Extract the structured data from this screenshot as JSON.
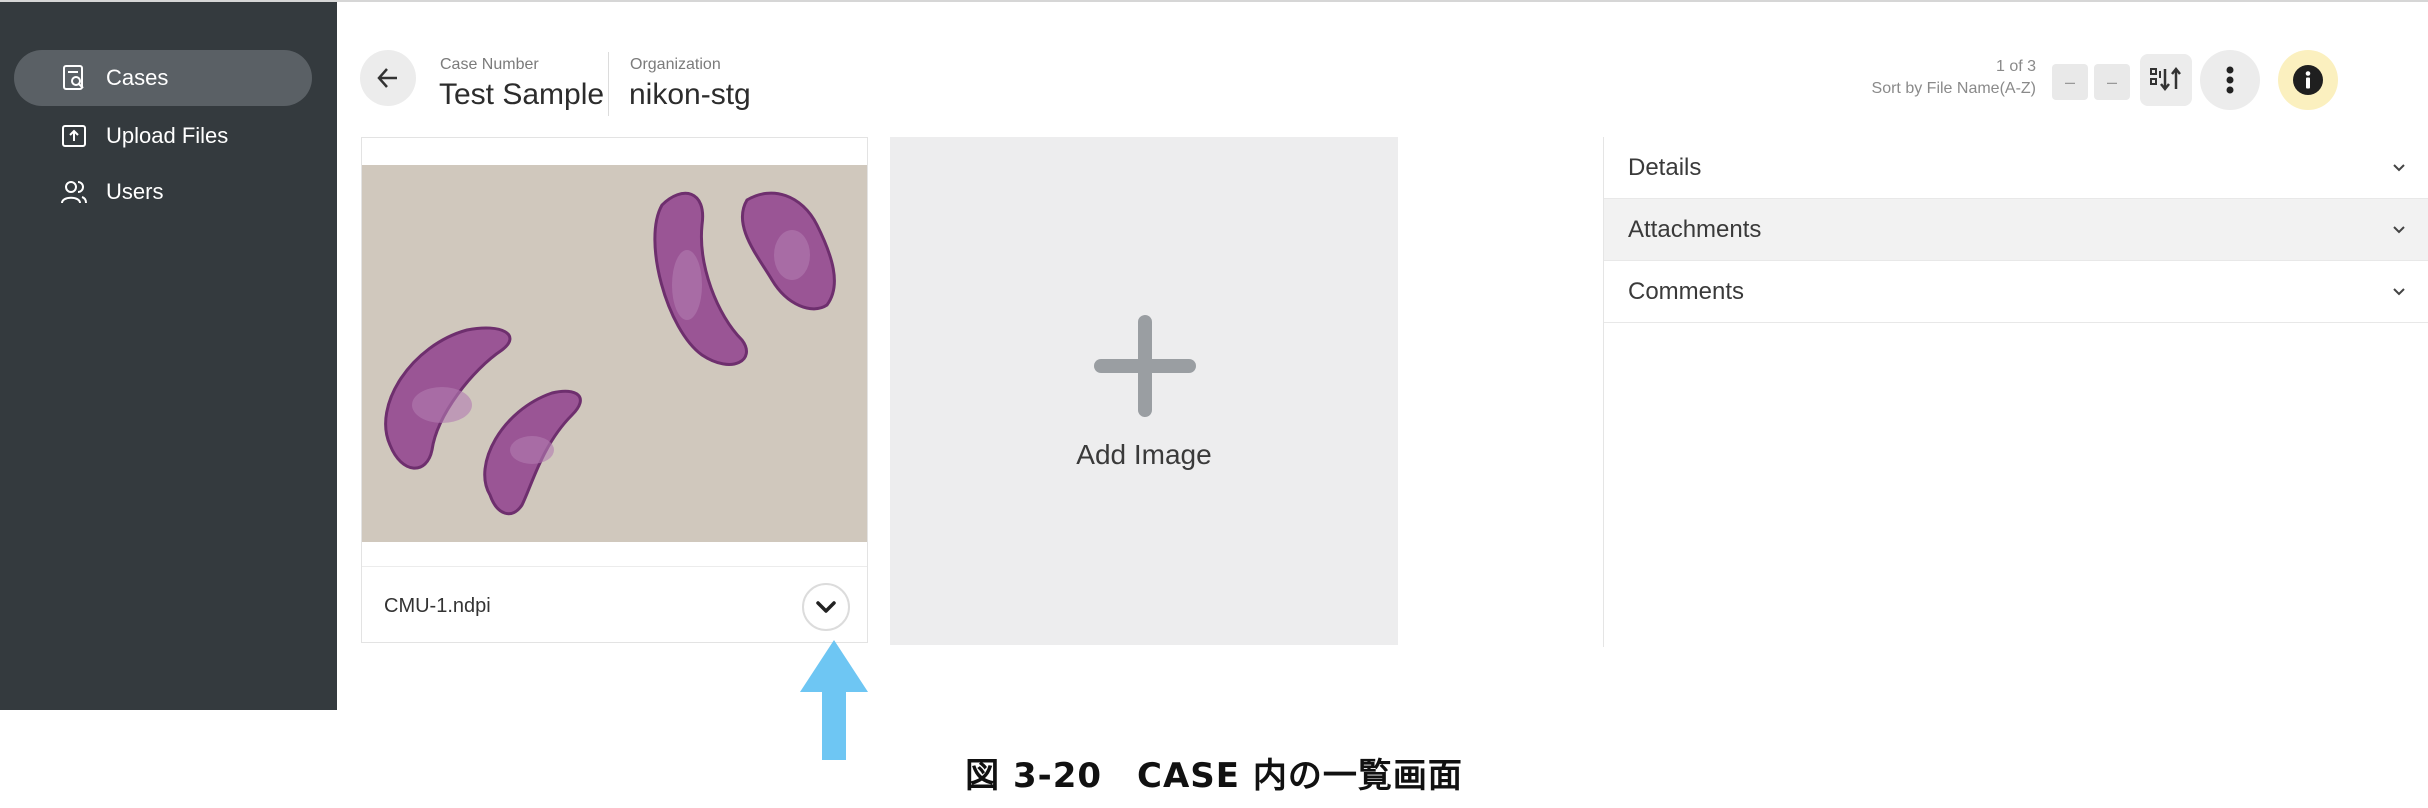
{
  "sidebar": {
    "items": [
      {
        "label": "Cases",
        "icon": "case-search-icon",
        "active": true
      },
      {
        "label": "Upload Files",
        "icon": "upload-icon",
        "active": false
      },
      {
        "label": "Users",
        "icon": "users-icon",
        "active": false
      }
    ]
  },
  "header": {
    "case_number_label": "Case Number",
    "case_number_value": "Test Sample",
    "organization_label": "Organization",
    "organization_value": "nikon-stg",
    "pager_text": "1 of 3",
    "sort_text": "Sort by File Name(A-Z)",
    "pager_prev": "–",
    "pager_next": "–"
  },
  "images": [
    {
      "filename": "CMU-1.ndpi"
    }
  ],
  "add_image_label": "Add Image",
  "panel": {
    "sections": [
      "Details",
      "Attachments",
      "Comments"
    ]
  },
  "caption": "図 3-20　CASE 内の一覧画面",
  "colors": {
    "sidebar_bg": "#343a3e",
    "sidebar_active": "#5a6065",
    "info_button_bg": "#fbf0bf",
    "arrow": "#6ec6f3"
  }
}
